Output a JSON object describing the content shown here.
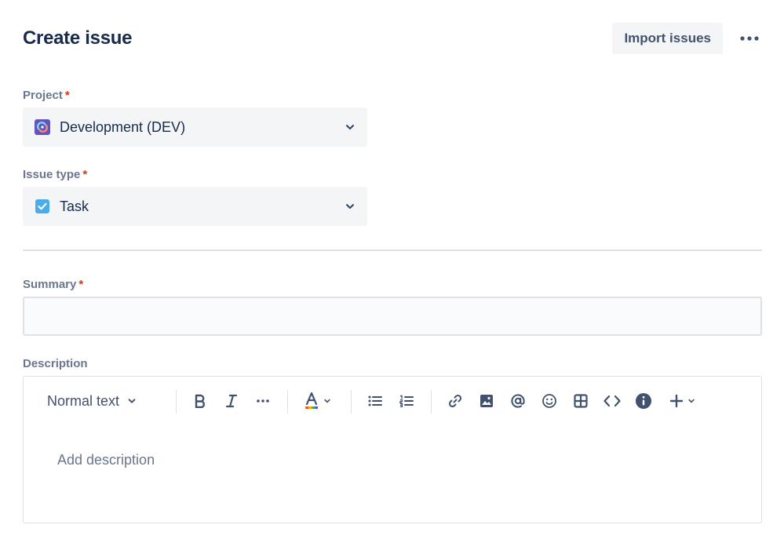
{
  "header": {
    "title": "Create issue",
    "import_label": "Import issues"
  },
  "fields": {
    "project": {
      "label": "Project",
      "required_mark": "*",
      "value": "Development (DEV)",
      "icon": "project-avatar-icon"
    },
    "issue_type": {
      "label": "Issue type",
      "required_mark": "*",
      "value": "Task",
      "icon": "task-checkbox-icon"
    },
    "summary": {
      "label": "Summary",
      "required_mark": "*",
      "value": ""
    },
    "description": {
      "label": "Description",
      "placeholder": "Add description"
    }
  },
  "toolbar": {
    "text_style": "Normal text",
    "buttons": [
      "bold-icon",
      "italic-icon",
      "more-formatting-icon",
      "text-color-icon",
      "bullet-list-icon",
      "numbered-list-icon",
      "link-icon",
      "image-icon",
      "mention-icon",
      "emoji-icon",
      "table-icon",
      "code-icon",
      "info-panel-icon",
      "insert-plus-icon"
    ]
  },
  "colors": {
    "primary_text": "#172B4D",
    "label_text": "#6B778C",
    "required": "#DE350B",
    "field_bg": "#F4F5F7",
    "task_icon": "#4BADE8",
    "project_icon": "#6554C0"
  }
}
